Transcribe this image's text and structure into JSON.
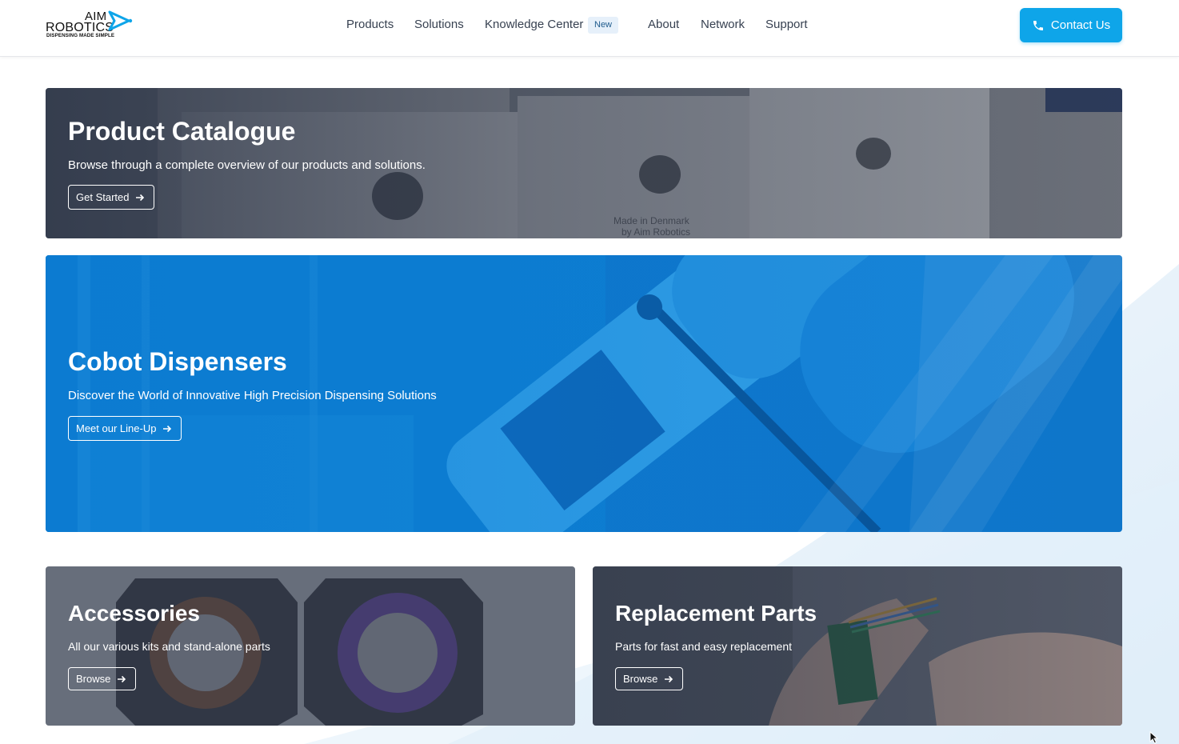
{
  "header": {
    "logo": {
      "top": "AIM",
      "main": "ROBOTICS",
      "tagline": "DISPENSING MADE SIMPLE",
      "icon": "play-arrow-logo-icon"
    },
    "nav": [
      {
        "label": "Products"
      },
      {
        "label": "Solutions"
      },
      {
        "label": "Knowledge Center",
        "badge": "New"
      },
      {
        "label": "About"
      },
      {
        "label": "Network"
      },
      {
        "label": "Support"
      }
    ],
    "contact": {
      "label": "Contact Us",
      "icon": "phone-icon"
    }
  },
  "cards": {
    "catalogue": {
      "title": "Product Catalogue",
      "subtitle": "Browse through a complete overview of our products and solutions.",
      "button": "Get Started"
    },
    "cobot": {
      "title": "Cobot Dispensers",
      "subtitle": "Discover the World of Innovative High Precision Dispensing Solutions",
      "button": "Meet our Line-Up"
    },
    "accessories": {
      "title": "Accessories",
      "subtitle": "All our various kits and stand-alone parts",
      "button": "Browse"
    },
    "replacement": {
      "title": "Replacement Parts",
      "subtitle": "Parts for fast and easy replacement",
      "button": "Browse"
    }
  },
  "colors": {
    "accent": "#0ea5e9",
    "badge_bg": "#e6f0fa",
    "cobot_overlay": "#0a7fd6",
    "dark_overlay": "#2b3446"
  }
}
